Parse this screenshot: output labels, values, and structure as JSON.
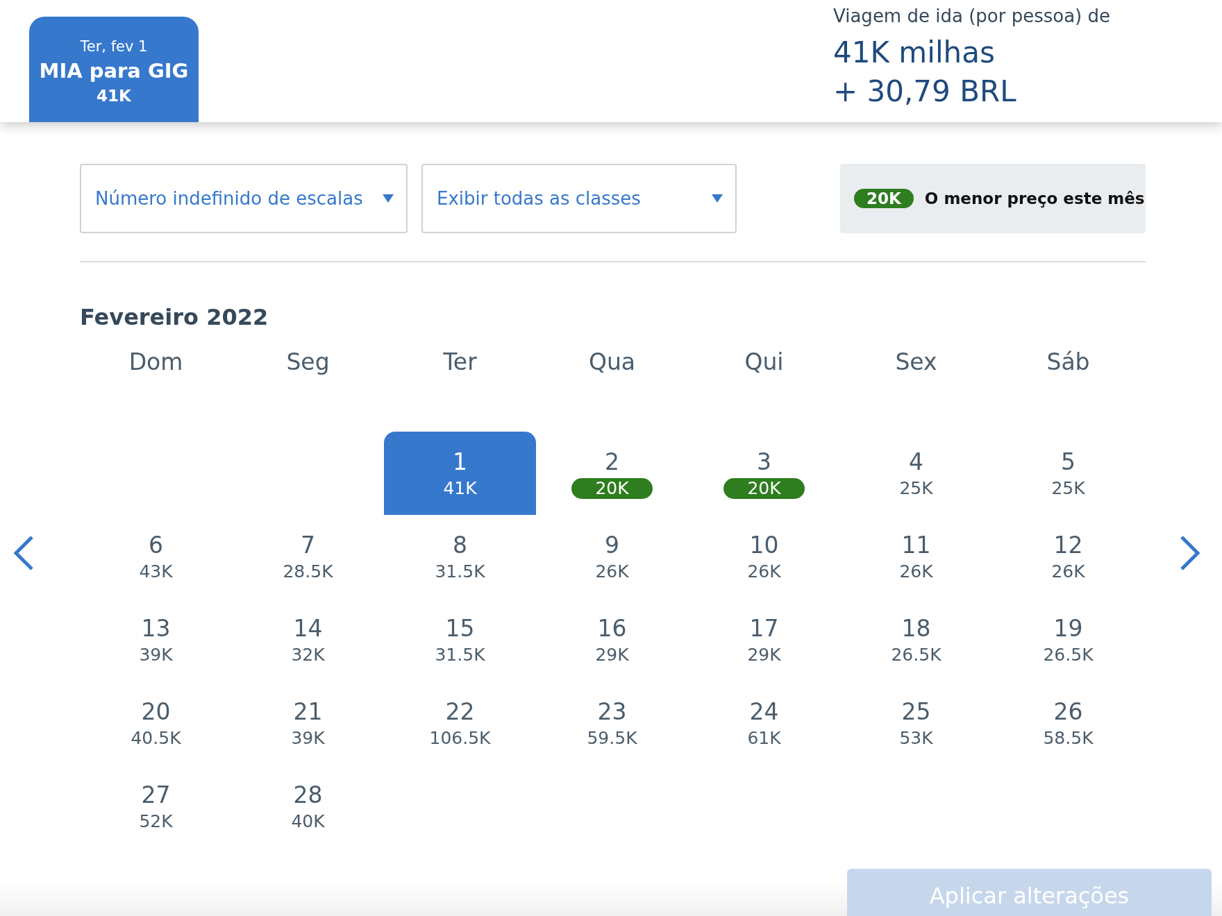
{
  "flight_tab": {
    "date": "Ter, fev 1",
    "route": "MIA para GIG",
    "miles": "41K",
    "selected": true
  },
  "fare_summary": {
    "label": "Viagem de ida (por pessoa) de",
    "miles": "41K milhas",
    "cash": "+ 30,79 BRL"
  },
  "filters": [
    {
      "value": "Número indefinido de escalas"
    },
    {
      "value": "Exibir todas as classes"
    }
  ],
  "legend": {
    "badge": "20K",
    "text": "O menor preço este mês"
  },
  "calendar": {
    "month": "Fevereiro 2022",
    "weekdays": [
      "Dom",
      "Seg",
      "Ter",
      "Qua",
      "Qui",
      "Sex",
      "Sáb"
    ],
    "weeks": [
      [
        {
          "kind": "empty"
        },
        {
          "kind": "empty"
        },
        {
          "kind": "day",
          "day": "1",
          "price": "41K",
          "selected": true,
          "lowest": false
        },
        {
          "kind": "day",
          "day": "2",
          "price": "20K",
          "selected": false,
          "lowest": true
        },
        {
          "kind": "day",
          "day": "3",
          "price": "20K",
          "selected": false,
          "lowest": true
        },
        {
          "kind": "day",
          "day": "4",
          "price": "25K",
          "selected": false,
          "lowest": false
        },
        {
          "kind": "day",
          "day": "5",
          "price": "25K",
          "selected": false,
          "lowest": false
        }
      ],
      [
        {
          "kind": "day",
          "day": "6",
          "price": "43K",
          "selected": false,
          "lowest": false
        },
        {
          "kind": "day",
          "day": "7",
          "price": "28.5K",
          "selected": false,
          "lowest": false
        },
        {
          "kind": "day",
          "day": "8",
          "price": "31.5K",
          "selected": false,
          "lowest": false
        },
        {
          "kind": "day",
          "day": "9",
          "price": "26K",
          "selected": false,
          "lowest": false
        },
        {
          "kind": "day",
          "day": "10",
          "price": "26K",
          "selected": false,
          "lowest": false
        },
        {
          "kind": "day",
          "day": "11",
          "price": "26K",
          "selected": false,
          "lowest": false
        },
        {
          "kind": "day",
          "day": "12",
          "price": "26K",
          "selected": false,
          "lowest": false
        }
      ],
      [
        {
          "kind": "day",
          "day": "13",
          "price": "39K",
          "selected": false,
          "lowest": false
        },
        {
          "kind": "day",
          "day": "14",
          "price": "32K",
          "selected": false,
          "lowest": false
        },
        {
          "kind": "day",
          "day": "15",
          "price": "31.5K",
          "selected": false,
          "lowest": false
        },
        {
          "kind": "day",
          "day": "16",
          "price": "29K",
          "selected": false,
          "lowest": false
        },
        {
          "kind": "day",
          "day": "17",
          "price": "29K",
          "selected": false,
          "lowest": false
        },
        {
          "kind": "day",
          "day": "18",
          "price": "26.5K",
          "selected": false,
          "lowest": false
        },
        {
          "kind": "day",
          "day": "19",
          "price": "26.5K",
          "selected": false,
          "lowest": false
        }
      ],
      [
        {
          "kind": "day",
          "day": "20",
          "price": "40.5K",
          "selected": false,
          "lowest": false
        },
        {
          "kind": "day",
          "day": "21",
          "price": "39K",
          "selected": false,
          "lowest": false
        },
        {
          "kind": "day",
          "day": "22",
          "price": "106.5K",
          "selected": false,
          "lowest": false
        },
        {
          "kind": "day",
          "day": "23",
          "price": "59.5K",
          "selected": false,
          "lowest": false
        },
        {
          "kind": "day",
          "day": "24",
          "price": "61K",
          "selected": false,
          "lowest": false
        },
        {
          "kind": "day",
          "day": "25",
          "price": "53K",
          "selected": false,
          "lowest": false
        },
        {
          "kind": "day",
          "day": "26",
          "price": "58.5K",
          "selected": false,
          "lowest": false
        }
      ],
      [
        {
          "kind": "day",
          "day": "27",
          "price": "52K",
          "selected": false,
          "lowest": false
        },
        {
          "kind": "day",
          "day": "28",
          "price": "40K",
          "selected": false,
          "lowest": false
        }
      ]
    ]
  },
  "apply_button": {
    "label": "Aplicar alterações",
    "disabled": true
  }
}
